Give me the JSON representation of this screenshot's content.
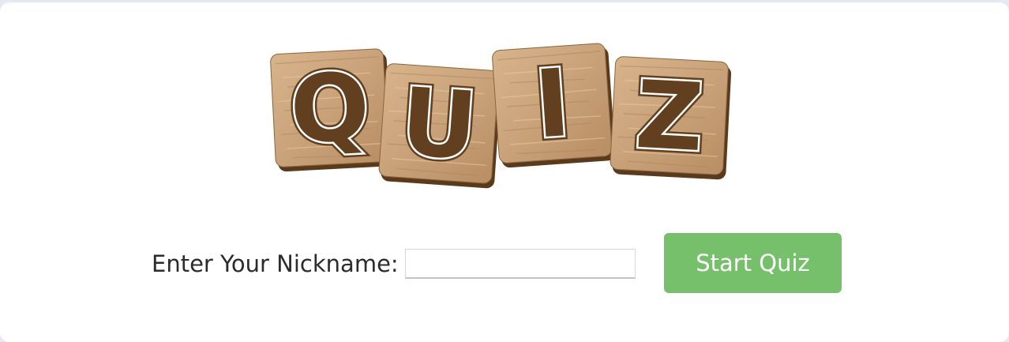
{
  "logo": {
    "tiles": [
      {
        "letter": "Q"
      },
      {
        "letter": "U"
      },
      {
        "letter": "I"
      },
      {
        "letter": "Z"
      }
    ]
  },
  "form": {
    "label": "Enter Your Nickname:",
    "input_value": "",
    "input_placeholder": "",
    "button_label": "Start Quiz"
  },
  "colors": {
    "accent": "#77c06b",
    "tile_wood": "#c9a27a",
    "tile_edge": "#5b3a1c",
    "letter": "#62401f"
  }
}
